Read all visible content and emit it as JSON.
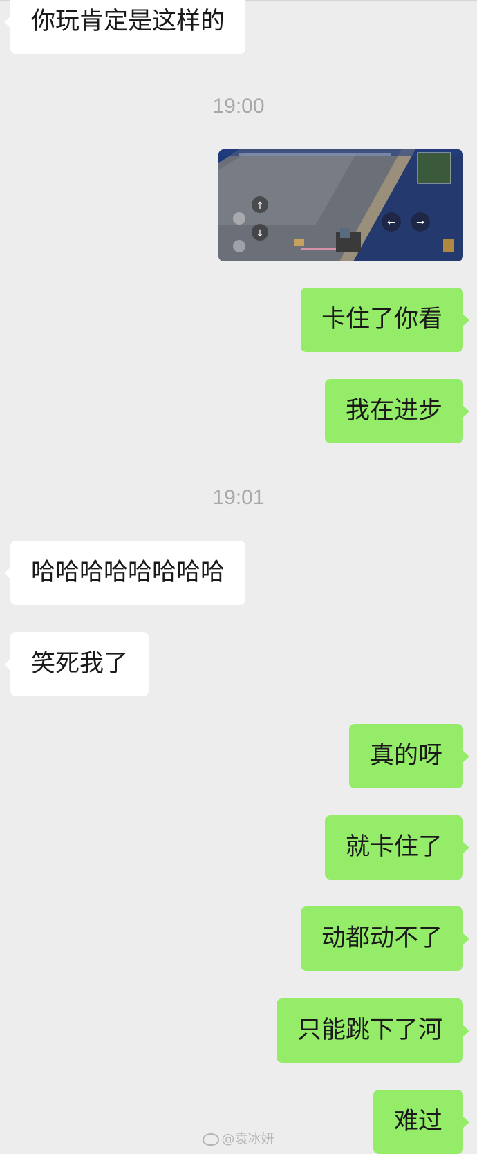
{
  "messages": {
    "m1": "你玩肯定是这样的",
    "m2": "卡住了你看",
    "m3": "我在进步",
    "m4": "哈哈哈哈哈哈哈哈",
    "m5": "笑死我了",
    "m6": "真的呀",
    "m7": "就卡住了",
    "m8": "动都动不了",
    "m9": "只能跳下了河",
    "m10": "难过"
  },
  "timestamps": {
    "t1": "19:00",
    "t2": "19:01"
  },
  "watermark": {
    "text": "@袁冰妍"
  },
  "colors": {
    "background": "#ededed",
    "incoming_bubble": "#ffffff",
    "outgoing_bubble": "#95ec69",
    "timestamp": "#a8a8a8"
  }
}
